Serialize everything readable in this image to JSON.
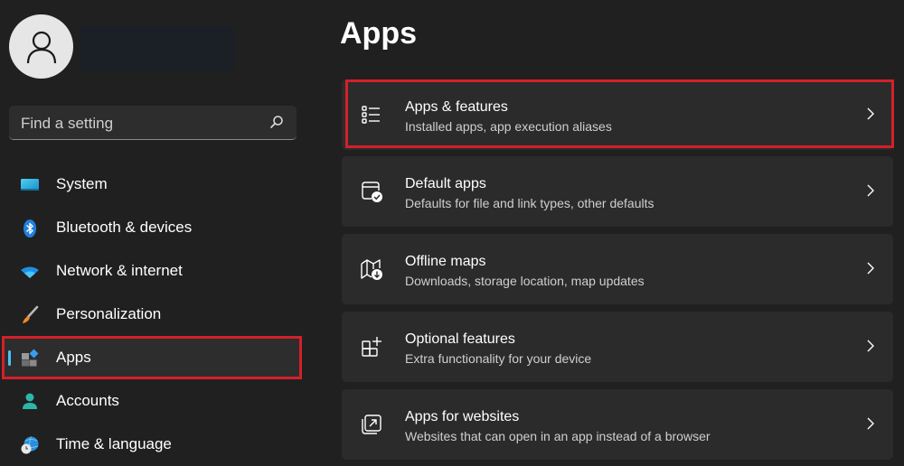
{
  "sidebar": {
    "user": {
      "avatar_icon": "person-icon",
      "name_redacted": true
    },
    "search": {
      "placeholder": "Find a setting",
      "value": "",
      "icon": "search-icon"
    },
    "items": [
      {
        "label": "System",
        "icon": "monitor-icon",
        "active": false
      },
      {
        "label": "Bluetooth & devices",
        "icon": "bluetooth-icon",
        "active": false
      },
      {
        "label": "Network & internet",
        "icon": "wifi-icon",
        "active": false
      },
      {
        "label": "Personalization",
        "icon": "paintbrush-icon",
        "active": false
      },
      {
        "label": "Apps",
        "icon": "apps-icon",
        "active": true
      },
      {
        "label": "Accounts",
        "icon": "person-icon",
        "active": false
      },
      {
        "label": "Time & language",
        "icon": "globe-clock-icon",
        "active": false
      }
    ]
  },
  "main": {
    "title": "Apps",
    "cards": [
      {
        "title": "Apps & features",
        "subtitle": "Installed apps, app execution aliases",
        "icon": "list-icon",
        "highlighted": true
      },
      {
        "title": "Default apps",
        "subtitle": "Defaults for file and link types, other defaults",
        "icon": "default-apps-icon",
        "highlighted": false
      },
      {
        "title": "Offline maps",
        "subtitle": "Downloads, storage location, map updates",
        "icon": "map-download-icon",
        "highlighted": false
      },
      {
        "title": "Optional features",
        "subtitle": "Extra functionality for your device",
        "icon": "grid-plus-icon",
        "highlighted": false
      },
      {
        "title": "Apps for websites",
        "subtitle": "Websites that can open in an app instead of a browser",
        "icon": "open-in-app-icon",
        "highlighted": false
      }
    ]
  },
  "colors": {
    "background": "#202020",
    "card": "#2b2b2b",
    "accent": "#4cc2ff",
    "highlight": "#d3202a"
  }
}
